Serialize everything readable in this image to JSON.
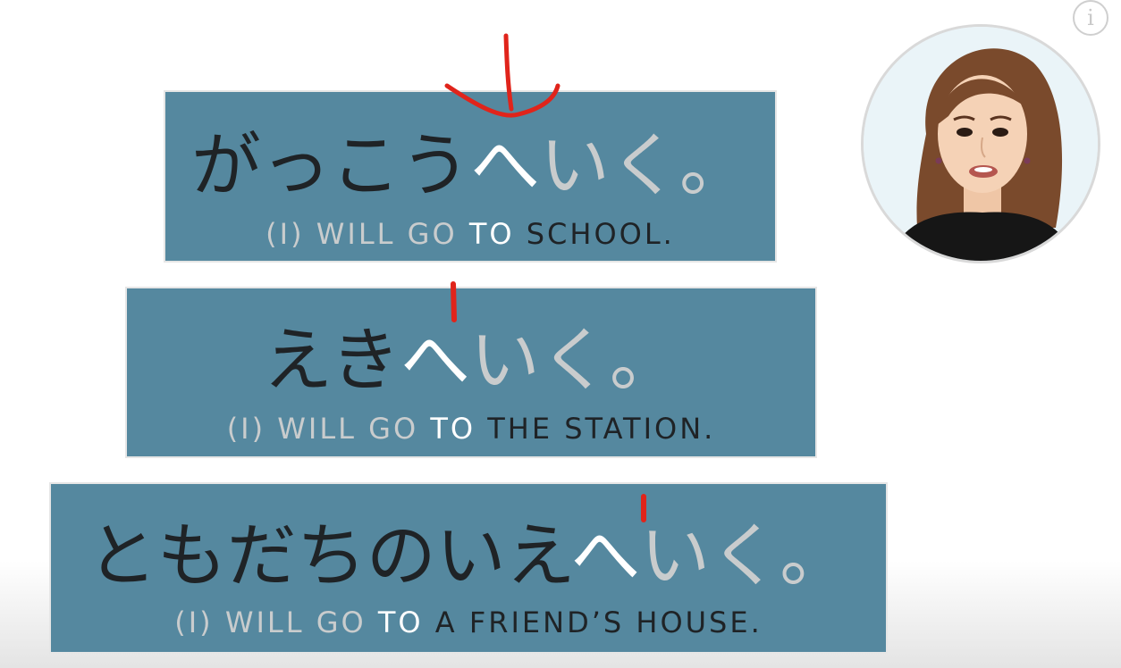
{
  "cards": [
    {
      "jp_dark": "がっこう",
      "jp_particle": "へ",
      "jp_verb": "いく。",
      "en_pre": "(I) WILL GO",
      "en_to": "TO",
      "en_object": "SCHOOL."
    },
    {
      "jp_dark": "えき",
      "jp_particle": "へ",
      "jp_verb": "いく。",
      "en_pre": "(I) WILL GO",
      "en_to": "TO",
      "en_object": "THE STATION."
    },
    {
      "jp_dark": "ともだちのいえ",
      "jp_particle": "へ",
      "jp_verb": "いく。",
      "en_pre": "(I) WILL GO",
      "en_to": "TO",
      "en_object": "A FRIEND’S HOUSE."
    }
  ],
  "info_button": {
    "glyph": "i"
  },
  "colors": {
    "card_background": "#55889f",
    "dark_text": "#1f2326",
    "highlight_text": "#ffffff",
    "muted_text": "#c9cccd",
    "annotation": "#e0241b"
  }
}
